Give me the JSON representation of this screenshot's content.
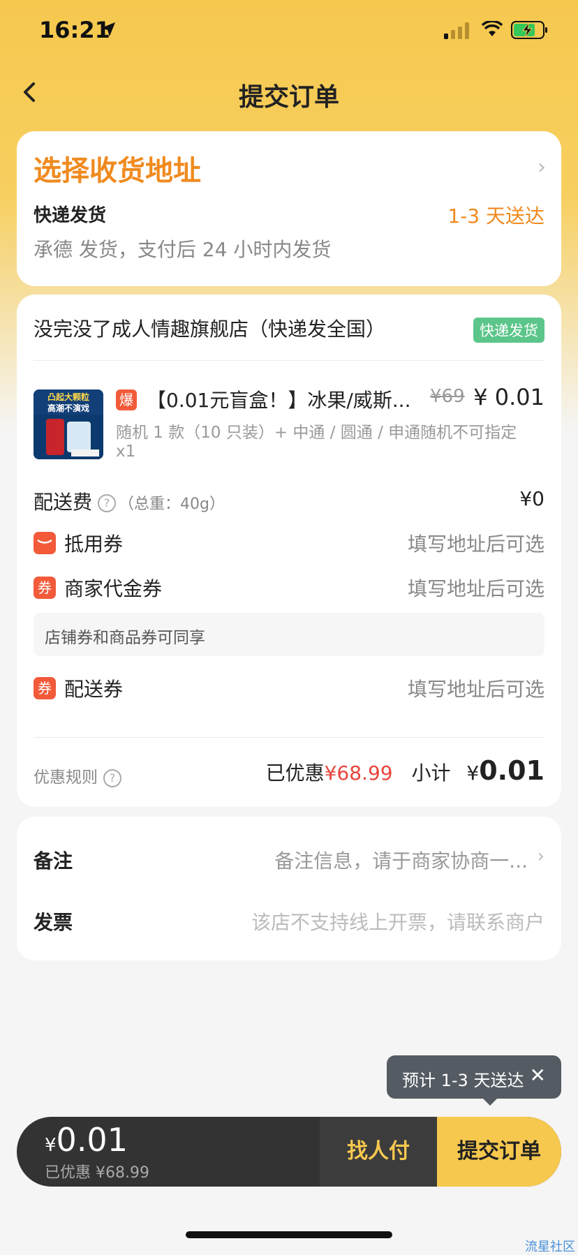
{
  "status_bar": {
    "time": "16:21"
  },
  "nav": {
    "title": "提交订单"
  },
  "address": {
    "title": "选择收货地址",
    "shipping_label": "快递发货",
    "eta": "1-3 天送达",
    "desc": "承德 发货，支付后 24 小时内发货"
  },
  "shop": {
    "name": "没完没了成人情趣旗舰店（快递发全国）",
    "badge": "快递发货"
  },
  "product": {
    "hot_badge": "爆",
    "title": "【0.01元盲盒！】冰果/威斯...",
    "original_price": "¥69",
    "price": "¥ 0.01",
    "spec": "随机 1 款（10 只装）+ 中通 / 圆通 / 申通随机不可指定",
    "qty": "x1",
    "image_text": "凸起大颗粒 高潮不演戏"
  },
  "delivery_fee": {
    "label": "配送费",
    "weight": "（总重：40g）",
    "value": "¥0"
  },
  "coupons": [
    {
      "icon": "wallet-icon",
      "label": "抵用券",
      "value": "填写地址后可选"
    },
    {
      "icon": "coupon-icon",
      "icon_char": "券",
      "label": "商家代金券",
      "value": "填写地址后可选"
    }
  ],
  "share_note": "店铺券和商品券可同享",
  "shipping_coupon": {
    "icon_char": "券",
    "label": "配送券",
    "value": "填写地址后可选"
  },
  "summary": {
    "rules": "优惠规则",
    "discount_label": "已优惠",
    "discount": "¥68.99",
    "subtotal_label": "小计",
    "subtotal_currency": "¥",
    "subtotal": "0.01"
  },
  "remark": {
    "label": "备注",
    "placeholder": "备注信息，请于商家协商一..."
  },
  "invoice": {
    "label": "发票",
    "value": "该店不支持线上开票，请联系商户"
  },
  "tooltip": {
    "text": "预计 1-3 天送达"
  },
  "bottom": {
    "currency": "¥",
    "total": "0.01",
    "discount": "已优惠 ¥68.99",
    "friend_pay": "找人付",
    "submit": "提交订单"
  },
  "watermark": "流星社区"
}
